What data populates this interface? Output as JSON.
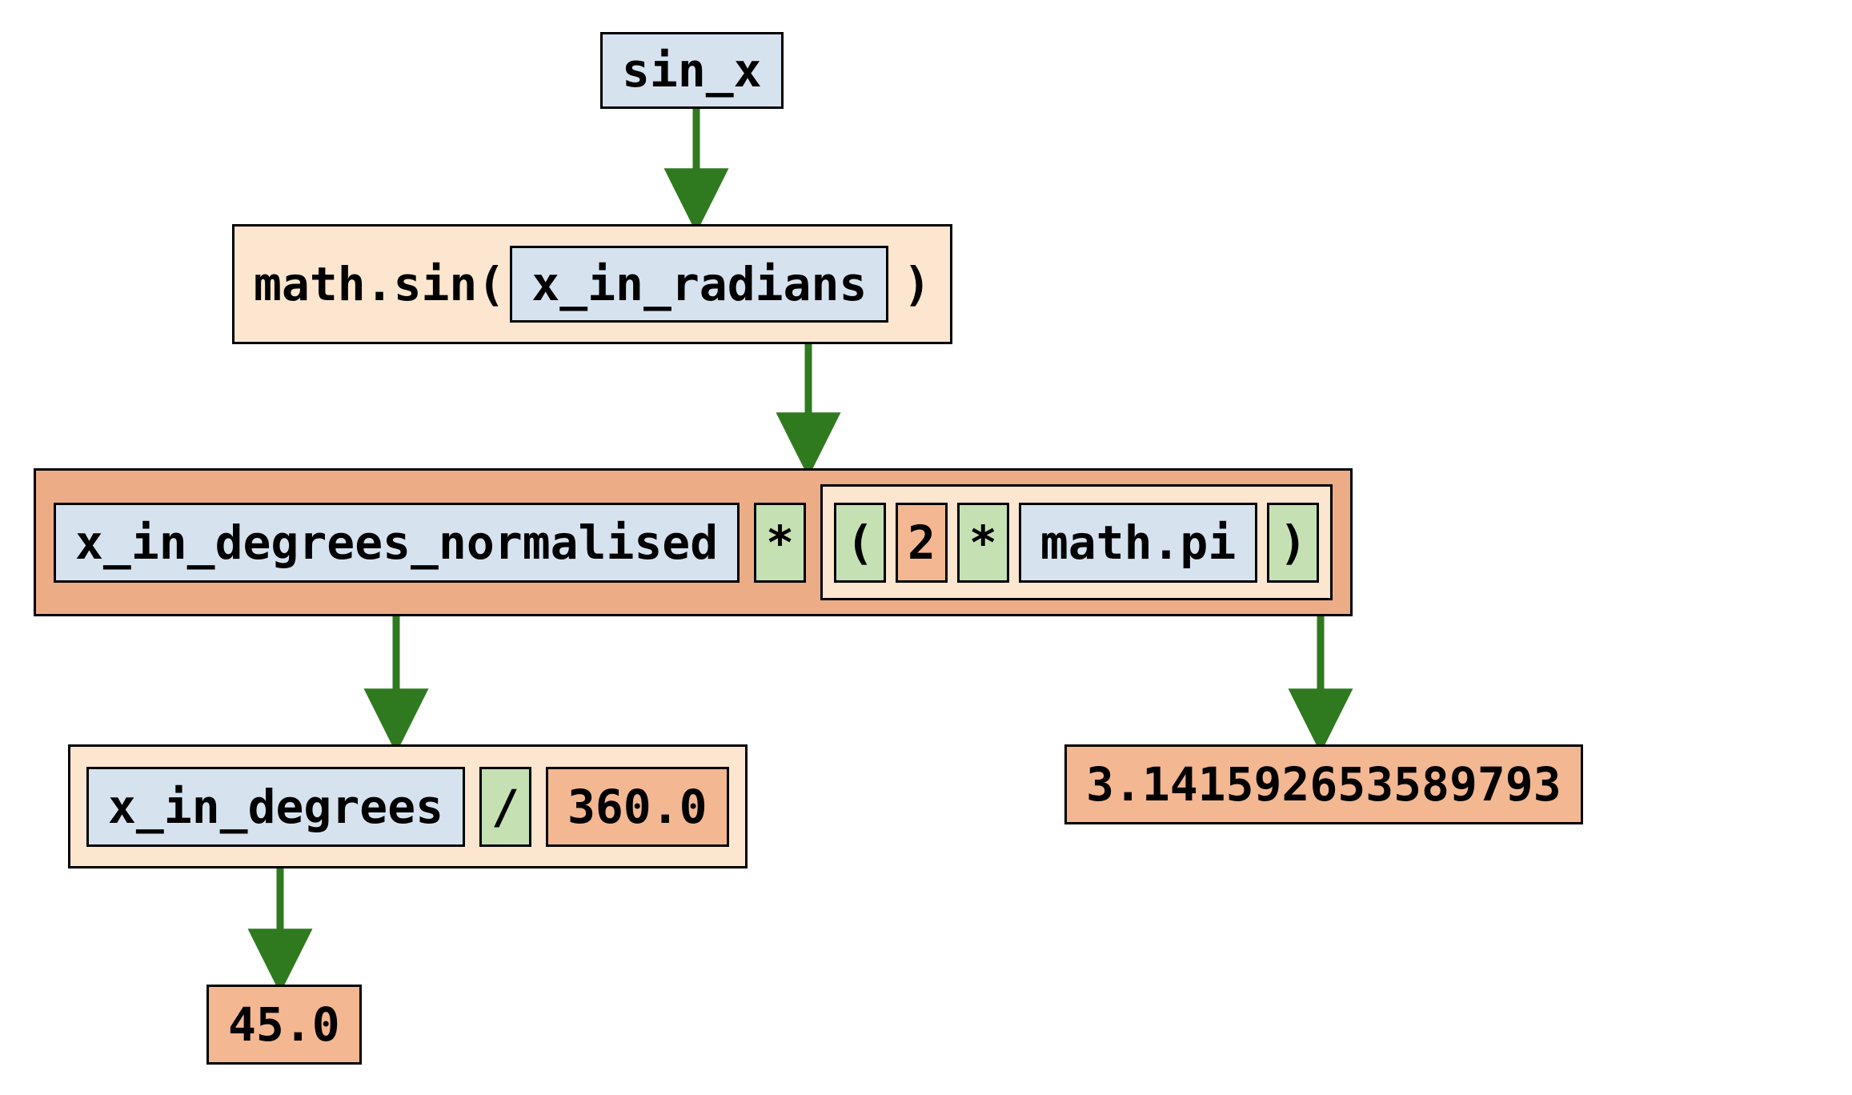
{
  "diagram": {
    "type": "expression-tree",
    "root": {
      "label": "sin_x"
    },
    "level1": {
      "prefix": "math.sin(",
      "arg": "x_in_radians",
      "suffix": ")"
    },
    "level2": {
      "lhs": "x_in_degrees_normalised",
      "op1": "*",
      "paren_open": "(",
      "const_2": "2",
      "op2": "*",
      "mathpi": "math.pi",
      "paren_close": ")"
    },
    "level3_left": {
      "var": "x_in_degrees",
      "op": "/",
      "val": "360.0"
    },
    "level3_right": {
      "pi_value": "3.141592653589793"
    },
    "leaf": {
      "deg_value": "45.0"
    }
  }
}
